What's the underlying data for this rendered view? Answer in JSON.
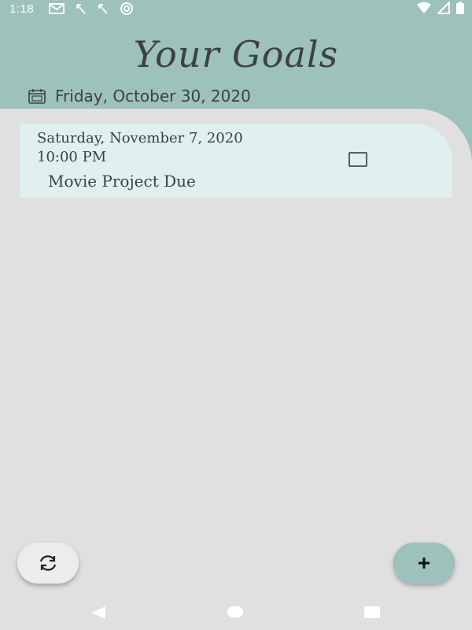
{
  "status_bar": {
    "time": "1:18",
    "left_icons": [
      "mail-icon",
      "missed-call-icon",
      "missed-call-icon",
      "sync-icon"
    ],
    "right_icons": [
      "wifi-icon",
      "signal-icon",
      "battery-icon"
    ]
  },
  "header": {
    "title": "Your Goals",
    "current_date": "Friday, October 30, 2020",
    "date_icon": "calendar-icon"
  },
  "goals": [
    {
      "date": "Saturday, November 7, 2020",
      "time": "10:00 PM",
      "title": "Movie Project Due",
      "checked": false
    }
  ],
  "actions": {
    "refresh_icon": "refresh-icon",
    "add_icon": "plus-icon"
  },
  "nav_bar": {
    "buttons": [
      "back",
      "home",
      "recents"
    ]
  },
  "colors": {
    "header": "#9cc2bb",
    "background": "#e0e0e0",
    "card": "#dff0ef",
    "text": "#3d4140"
  }
}
